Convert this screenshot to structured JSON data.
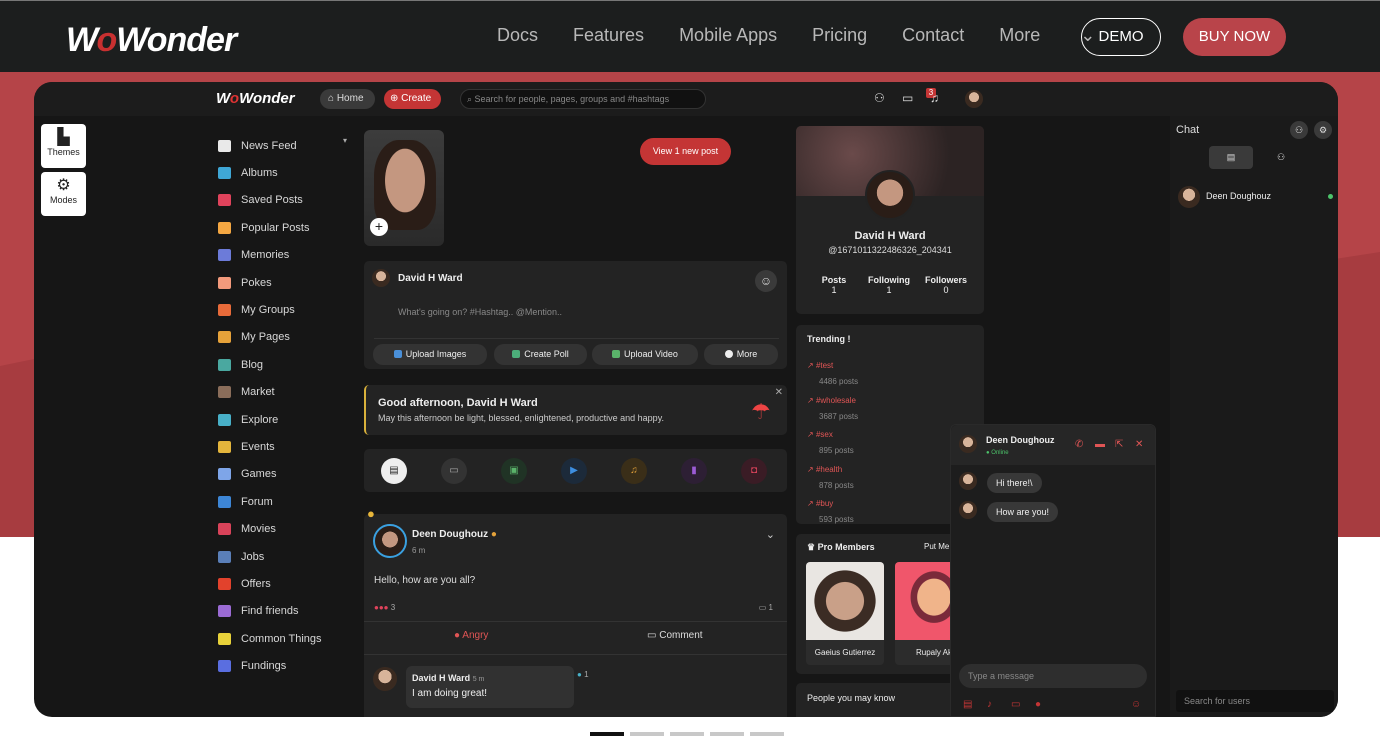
{
  "site": {
    "logo": "WoWonder",
    "nav": [
      "Docs",
      "Features",
      "Mobile Apps",
      "Pricing",
      "Contact",
      "More"
    ],
    "demo": "DEMO",
    "buy": "BUY NOW"
  },
  "app": {
    "logo": "WoWonder",
    "home": "Home",
    "create": "Create",
    "search_placeholder": "Search for people, pages, groups and #hashtags",
    "notif_count": "3",
    "tools": [
      {
        "label": "Themes"
      },
      {
        "label": "Modes"
      }
    ],
    "menu": [
      {
        "label": "News Feed",
        "color": "#e9e9e9"
      },
      {
        "label": "Albums",
        "color": "#3fa7d6"
      },
      {
        "label": "Saved Posts",
        "color": "#e0435c"
      },
      {
        "label": "Popular Posts",
        "color": "#f4a742"
      },
      {
        "label": "Memories",
        "color": "#6c7bd9"
      },
      {
        "label": "Pokes",
        "color": "#f39a7c"
      },
      {
        "label": "My Groups",
        "color": "#e86b3a"
      },
      {
        "label": "My Pages",
        "color": "#e6a23a"
      },
      {
        "label": "Blog",
        "color": "#4aa8a0"
      },
      {
        "label": "Market",
        "color": "#8a6d5a"
      },
      {
        "label": "Explore",
        "color": "#48b0c8"
      },
      {
        "label": "Events",
        "color": "#e4b53c"
      },
      {
        "label": "Games",
        "color": "#7ea5e8"
      },
      {
        "label": "Forum",
        "color": "#3d86d6"
      },
      {
        "label": "Movies",
        "color": "#d9435a"
      },
      {
        "label": "Jobs",
        "color": "#5a7fb8"
      },
      {
        "label": "Offers",
        "color": "#e2422c"
      },
      {
        "label": "Find friends",
        "color": "#9b6bd4"
      },
      {
        "label": "Common Things",
        "color": "#e8d23a"
      },
      {
        "label": "Fundings",
        "color": "#5a6ee0"
      }
    ],
    "new_post_btn": "View 1 new post",
    "composer": {
      "name": "David H Ward",
      "placeholder": "What's going on? #Hashtag.. @Mention..",
      "buttons": [
        "Upload Images",
        "Create Poll",
        "Upload Video",
        "More"
      ]
    },
    "greeting": {
      "title": "Good afternoon, David H Ward",
      "text": "May this afternoon be light, blessed, enlightened, productive and happy."
    },
    "post": {
      "author": "Deen Doughouz",
      "time": "6 m",
      "text": "Hello, how are you all?",
      "reaction_count": "3",
      "comment_count": "1",
      "angry_label": "Angry",
      "comment_label": "Comment",
      "comment": {
        "author": "David H Ward",
        "time": "5 m",
        "text": "I am doing great!",
        "likes": "1"
      }
    },
    "profile": {
      "name": "David H Ward",
      "handle": "@1671011322486326_204341",
      "stats": [
        {
          "label": "Posts",
          "value": "1"
        },
        {
          "label": "Following",
          "value": "1"
        },
        {
          "label": "Followers",
          "value": "0"
        }
      ]
    },
    "trending": {
      "title": "Trending !",
      "items": [
        {
          "tag": "#test",
          "count": "4486 posts"
        },
        {
          "tag": "#wholesale",
          "count": "3687 posts"
        },
        {
          "tag": "#sex",
          "count": "895 posts"
        },
        {
          "tag": "#health",
          "count": "878 posts"
        },
        {
          "tag": "#buy",
          "count": "593 posts"
        }
      ]
    },
    "pro_members": {
      "title": "Pro Members",
      "action": "Put Me",
      "members": [
        "Gaeius Gutierrez",
        "Rupaly Ak"
      ]
    },
    "people_you_may_know": "People you may know",
    "chat_window": {
      "name": "Deen Doughouz",
      "status": "Online",
      "messages": [
        "Hi there!\\",
        "How are you!"
      ],
      "input_placeholder": "Type a message"
    },
    "chat_sidebar": {
      "title": "Chat",
      "user": "Deen Doughouz",
      "search_placeholder": "Search for users"
    }
  }
}
